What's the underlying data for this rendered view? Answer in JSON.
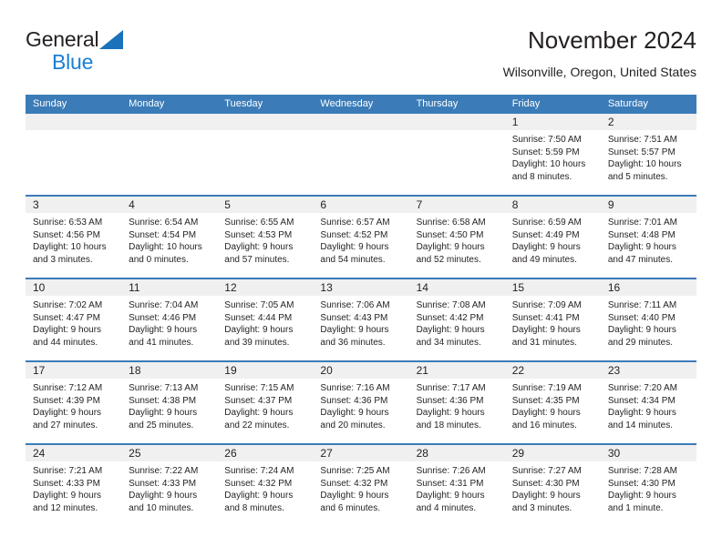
{
  "brand": {
    "word1": "General",
    "word2": "Blue",
    "flag_color": "#1a72ba",
    "word2_color": "#1b7fd4"
  },
  "header": {
    "title": "November 2024",
    "subtitle": "Wilsonville, Oregon, United States"
  },
  "theme": {
    "header_blue": "#3b7cb8",
    "day_band_gray": "#f0f0f0",
    "text_color": "#231f20"
  },
  "calendar": {
    "day_headers": [
      "Sunday",
      "Monday",
      "Tuesday",
      "Wednesday",
      "Thursday",
      "Friday",
      "Saturday"
    ],
    "weeks": [
      [
        {
          "day": "",
          "lines": []
        },
        {
          "day": "",
          "lines": []
        },
        {
          "day": "",
          "lines": []
        },
        {
          "day": "",
          "lines": []
        },
        {
          "day": "",
          "lines": []
        },
        {
          "day": "1",
          "lines": [
            "Sunrise: 7:50 AM",
            "Sunset: 5:59 PM",
            "Daylight: 10 hours",
            "and 8 minutes."
          ]
        },
        {
          "day": "2",
          "lines": [
            "Sunrise: 7:51 AM",
            "Sunset: 5:57 PM",
            "Daylight: 10 hours",
            "and 5 minutes."
          ]
        }
      ],
      [
        {
          "day": "3",
          "lines": [
            "Sunrise: 6:53 AM",
            "Sunset: 4:56 PM",
            "Daylight: 10 hours",
            "and 3 minutes."
          ]
        },
        {
          "day": "4",
          "lines": [
            "Sunrise: 6:54 AM",
            "Sunset: 4:54 PM",
            "Daylight: 10 hours",
            "and 0 minutes."
          ]
        },
        {
          "day": "5",
          "lines": [
            "Sunrise: 6:55 AM",
            "Sunset: 4:53 PM",
            "Daylight: 9 hours",
            "and 57 minutes."
          ]
        },
        {
          "day": "6",
          "lines": [
            "Sunrise: 6:57 AM",
            "Sunset: 4:52 PM",
            "Daylight: 9 hours",
            "and 54 minutes."
          ]
        },
        {
          "day": "7",
          "lines": [
            "Sunrise: 6:58 AM",
            "Sunset: 4:50 PM",
            "Daylight: 9 hours",
            "and 52 minutes."
          ]
        },
        {
          "day": "8",
          "lines": [
            "Sunrise: 6:59 AM",
            "Sunset: 4:49 PM",
            "Daylight: 9 hours",
            "and 49 minutes."
          ]
        },
        {
          "day": "9",
          "lines": [
            "Sunrise: 7:01 AM",
            "Sunset: 4:48 PM",
            "Daylight: 9 hours",
            "and 47 minutes."
          ]
        }
      ],
      [
        {
          "day": "10",
          "lines": [
            "Sunrise: 7:02 AM",
            "Sunset: 4:47 PM",
            "Daylight: 9 hours",
            "and 44 minutes."
          ]
        },
        {
          "day": "11",
          "lines": [
            "Sunrise: 7:04 AM",
            "Sunset: 4:46 PM",
            "Daylight: 9 hours",
            "and 41 minutes."
          ]
        },
        {
          "day": "12",
          "lines": [
            "Sunrise: 7:05 AM",
            "Sunset: 4:44 PM",
            "Daylight: 9 hours",
            "and 39 minutes."
          ]
        },
        {
          "day": "13",
          "lines": [
            "Sunrise: 7:06 AM",
            "Sunset: 4:43 PM",
            "Daylight: 9 hours",
            "and 36 minutes."
          ]
        },
        {
          "day": "14",
          "lines": [
            "Sunrise: 7:08 AM",
            "Sunset: 4:42 PM",
            "Daylight: 9 hours",
            "and 34 minutes."
          ]
        },
        {
          "day": "15",
          "lines": [
            "Sunrise: 7:09 AM",
            "Sunset: 4:41 PM",
            "Daylight: 9 hours",
            "and 31 minutes."
          ]
        },
        {
          "day": "16",
          "lines": [
            "Sunrise: 7:11 AM",
            "Sunset: 4:40 PM",
            "Daylight: 9 hours",
            "and 29 minutes."
          ]
        }
      ],
      [
        {
          "day": "17",
          "lines": [
            "Sunrise: 7:12 AM",
            "Sunset: 4:39 PM",
            "Daylight: 9 hours",
            "and 27 minutes."
          ]
        },
        {
          "day": "18",
          "lines": [
            "Sunrise: 7:13 AM",
            "Sunset: 4:38 PM",
            "Daylight: 9 hours",
            "and 25 minutes."
          ]
        },
        {
          "day": "19",
          "lines": [
            "Sunrise: 7:15 AM",
            "Sunset: 4:37 PM",
            "Daylight: 9 hours",
            "and 22 minutes."
          ]
        },
        {
          "day": "20",
          "lines": [
            "Sunrise: 7:16 AM",
            "Sunset: 4:36 PM",
            "Daylight: 9 hours",
            "and 20 minutes."
          ]
        },
        {
          "day": "21",
          "lines": [
            "Sunrise: 7:17 AM",
            "Sunset: 4:36 PM",
            "Daylight: 9 hours",
            "and 18 minutes."
          ]
        },
        {
          "day": "22",
          "lines": [
            "Sunrise: 7:19 AM",
            "Sunset: 4:35 PM",
            "Daylight: 9 hours",
            "and 16 minutes."
          ]
        },
        {
          "day": "23",
          "lines": [
            "Sunrise: 7:20 AM",
            "Sunset: 4:34 PM",
            "Daylight: 9 hours",
            "and 14 minutes."
          ]
        }
      ],
      [
        {
          "day": "24",
          "lines": [
            "Sunrise: 7:21 AM",
            "Sunset: 4:33 PM",
            "Daylight: 9 hours",
            "and 12 minutes."
          ]
        },
        {
          "day": "25",
          "lines": [
            "Sunrise: 7:22 AM",
            "Sunset: 4:33 PM",
            "Daylight: 9 hours",
            "and 10 minutes."
          ]
        },
        {
          "day": "26",
          "lines": [
            "Sunrise: 7:24 AM",
            "Sunset: 4:32 PM",
            "Daylight: 9 hours",
            "and 8 minutes."
          ]
        },
        {
          "day": "27",
          "lines": [
            "Sunrise: 7:25 AM",
            "Sunset: 4:32 PM",
            "Daylight: 9 hours",
            "and 6 minutes."
          ]
        },
        {
          "day": "28",
          "lines": [
            "Sunrise: 7:26 AM",
            "Sunset: 4:31 PM",
            "Daylight: 9 hours",
            "and 4 minutes."
          ]
        },
        {
          "day": "29",
          "lines": [
            "Sunrise: 7:27 AM",
            "Sunset: 4:30 PM",
            "Daylight: 9 hours",
            "and 3 minutes."
          ]
        },
        {
          "day": "30",
          "lines": [
            "Sunrise: 7:28 AM",
            "Sunset: 4:30 PM",
            "Daylight: 9 hours",
            "and 1 minute."
          ]
        }
      ]
    ]
  }
}
